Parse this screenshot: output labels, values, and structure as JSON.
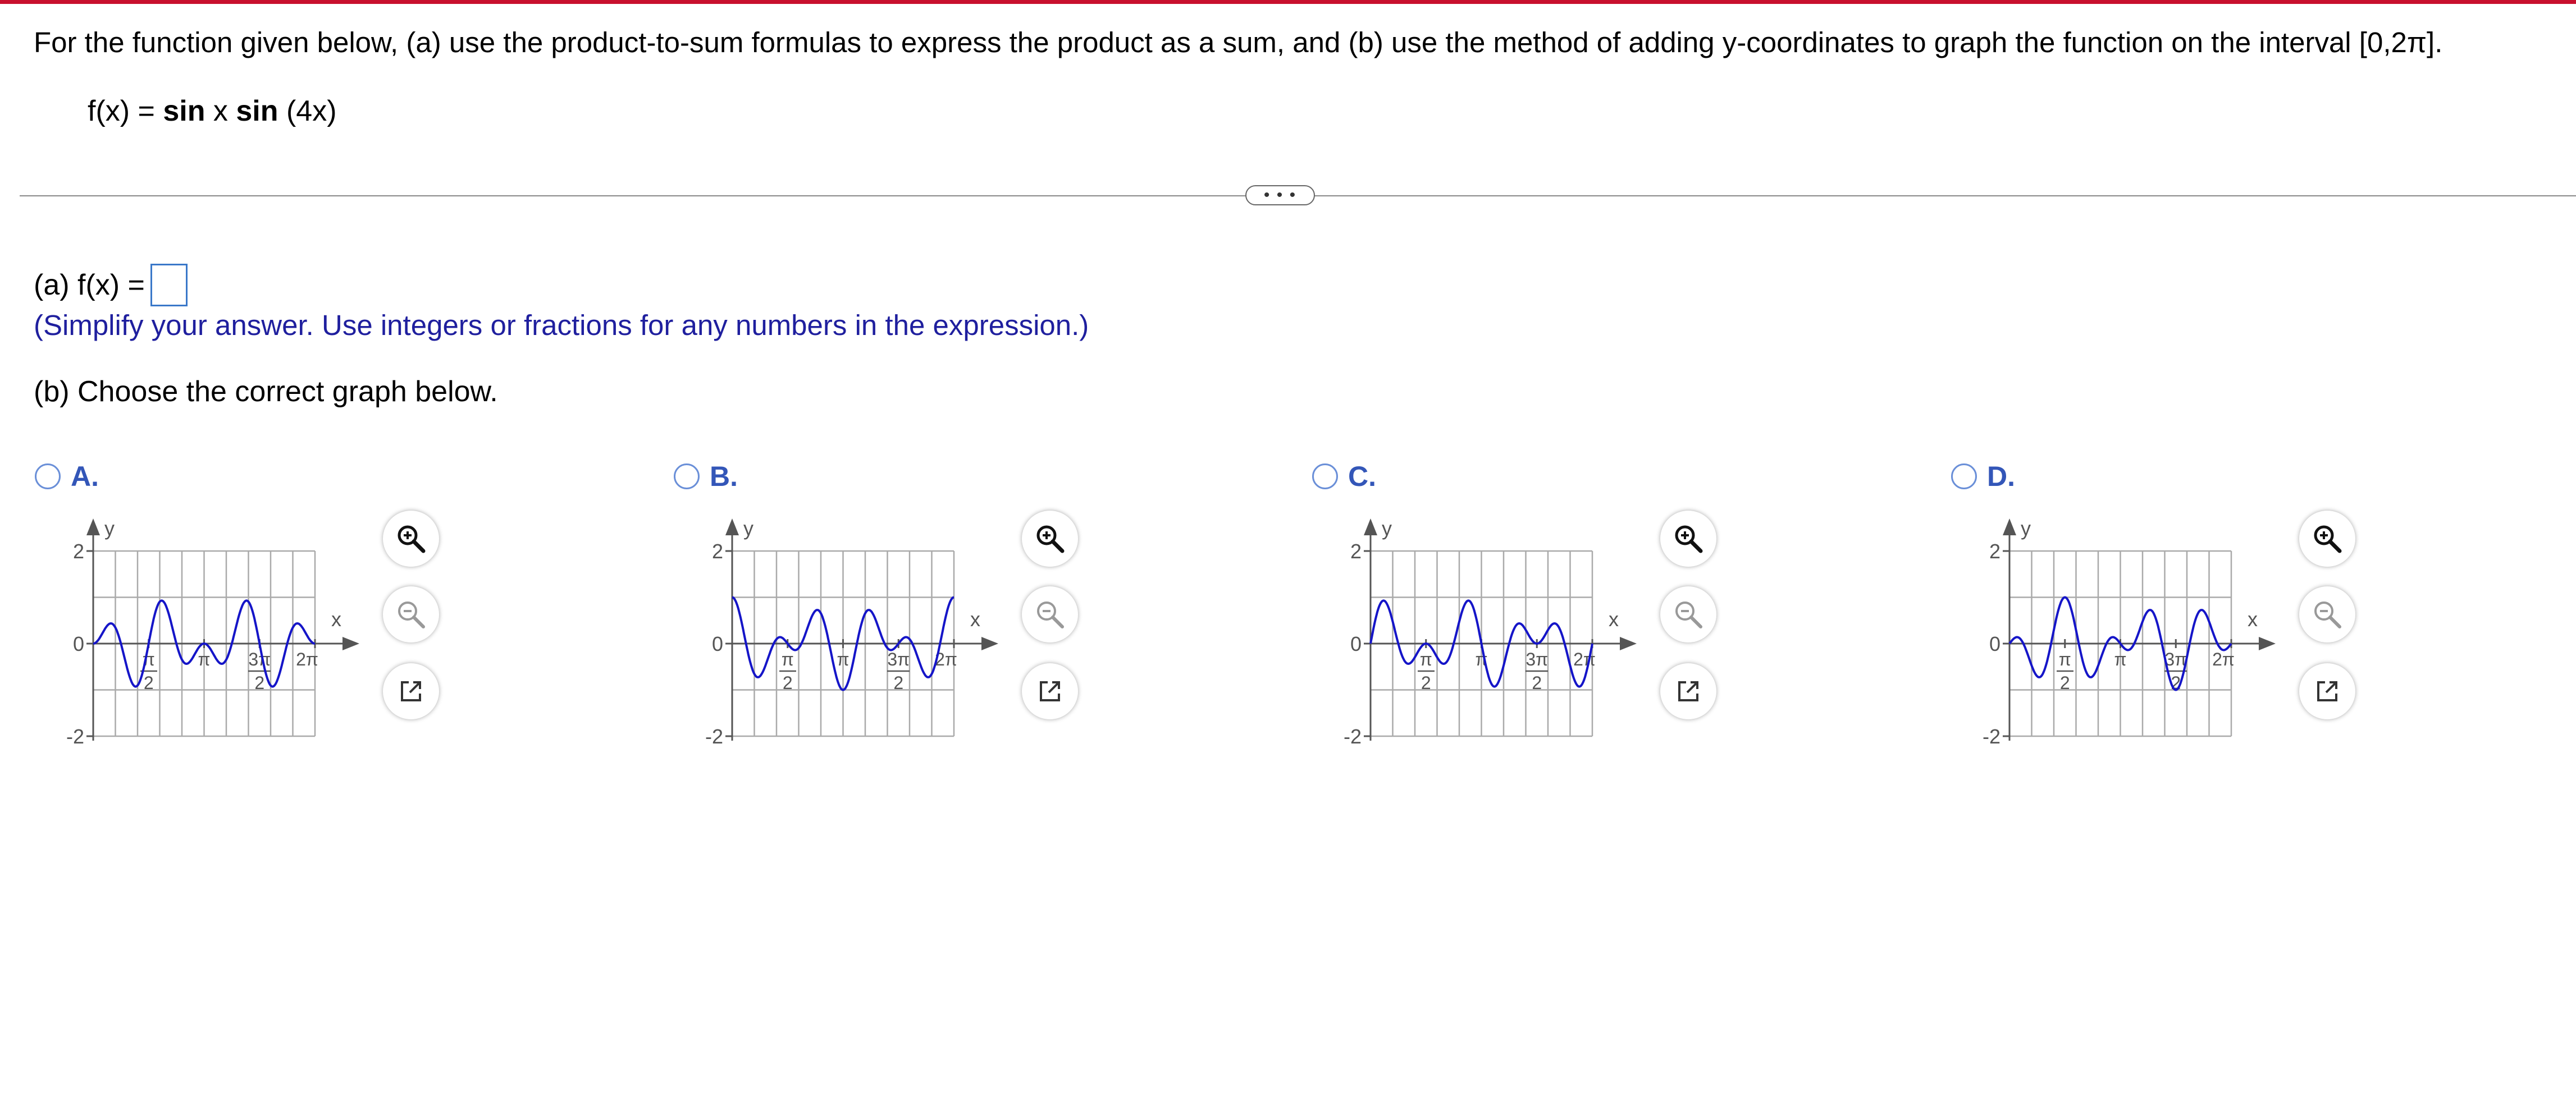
{
  "question": {
    "prompt": "For the function given below, (a) use the product-to-sum formulas to express the product as a sum, and (b) use the method of adding y-coordinates to graph the function on the interval [0,2π].",
    "function_lhs": "f(x) = ",
    "function_sin1": "sin",
    "function_x": " x ",
    "function_sin2": "sin",
    "function_arg": " (4x)"
  },
  "toolbar": {
    "more_label": "• • •"
  },
  "part_a": {
    "label": "(a) f(x) =",
    "answer_value": "",
    "hint": "(Simplify your answer. Use integers or fractions for any numbers in the expression.)"
  },
  "part_b": {
    "label": "(b) Choose the correct graph below."
  },
  "options": [
    {
      "letter": "A.",
      "amplitude": 0.5
    },
    {
      "letter": "B.",
      "amplitude": 1.0
    },
    {
      "letter": "C.",
      "amplitude": 1.0
    },
    {
      "letter": "D.",
      "amplitude": 1.0
    }
  ],
  "graph_labels": {
    "y_axis": "y",
    "x_axis": "x",
    "y_top": "2",
    "y_zero": "0",
    "y_bottom": "-2",
    "pi_over_2_num": "π",
    "pi_over_2_den": "2",
    "pi": "π",
    "three_pi_over_2_num": "3π",
    "three_pi_over_2_den": "2",
    "two_pi": "2π"
  },
  "colors": {
    "curve": "#1515c8",
    "radio": "#6a8fd8",
    "accent": "#c8102e"
  },
  "icons": [
    "zoom-in-icon",
    "zoom-out-icon",
    "popout-icon"
  ]
}
